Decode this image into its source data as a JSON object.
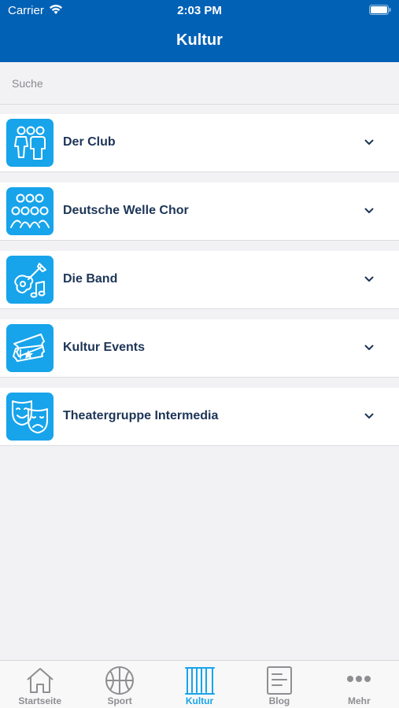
{
  "status_bar": {
    "carrier": "Carrier",
    "time": "2:03 PM"
  },
  "nav": {
    "title": "Kultur"
  },
  "search": {
    "placeholder": "Suche",
    "value": ""
  },
  "items": [
    {
      "label": "Der Club",
      "icon": "people-icon"
    },
    {
      "label": "Deutsche Welle Chor",
      "icon": "choir-icon"
    },
    {
      "label": "Die Band",
      "icon": "guitar-icon"
    },
    {
      "label": "Kultur Events",
      "icon": "ticket-icon"
    },
    {
      "label": "Theatergruppe Intermedia",
      "icon": "theater-masks-icon"
    }
  ],
  "tabs": [
    {
      "label": "Startseite",
      "icon": "home-icon",
      "active": false
    },
    {
      "label": "Sport",
      "icon": "basketball-icon",
      "active": false
    },
    {
      "label": "Kultur",
      "icon": "curtain-icon",
      "active": true
    },
    {
      "label": "Blog",
      "icon": "document-icon",
      "active": false
    },
    {
      "label": "Mehr",
      "icon": "more-icon",
      "active": false
    }
  ],
  "colors": {
    "header": "#0061b5",
    "accent": "#17a4eb",
    "item_text": "#1d3557",
    "tab_inactive": "#8e8e93"
  }
}
